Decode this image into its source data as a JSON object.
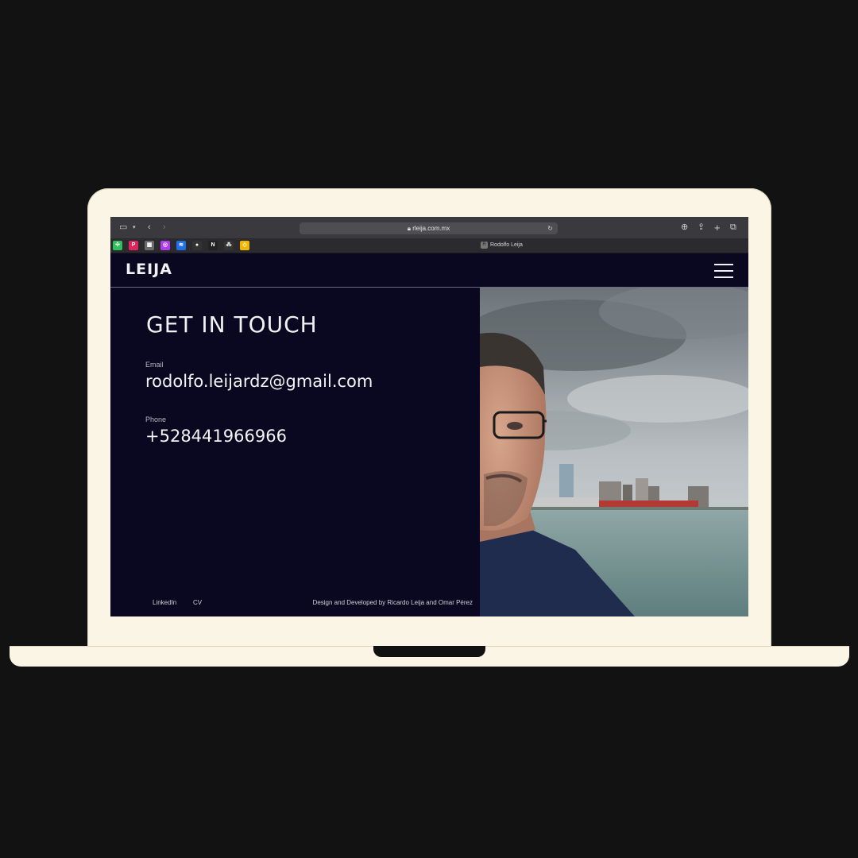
{
  "browser": {
    "url": "rleija.com.mx",
    "tab_title": "Rodolfo Leija",
    "tab_favicon_letter": "R",
    "favorites": [
      {
        "name": "app-icon-1",
        "color": "#2fbf5b",
        "glyph": "✣"
      },
      {
        "name": "app-icon-2",
        "color": "#e0245e",
        "glyph": "P"
      },
      {
        "name": "app-icon-3",
        "color": "#6b6b6b",
        "glyph": "▦"
      },
      {
        "name": "app-icon-4",
        "color": "#b03cf0",
        "glyph": "◎"
      },
      {
        "name": "app-icon-5",
        "color": "#1e6fe8",
        "glyph": "≋"
      },
      {
        "name": "github-icon",
        "color": "#333333",
        "glyph": "●"
      },
      {
        "name": "app-icon-7",
        "color": "#222222",
        "glyph": "N"
      },
      {
        "name": "app-icon-8",
        "color": "#333333",
        "glyph": "⁂"
      },
      {
        "name": "app-icon-9",
        "color": "#f1b600",
        "glyph": "◇"
      }
    ]
  },
  "site": {
    "logo": "LEIJA",
    "heading": "GET IN TOUCH",
    "email_label": "Email",
    "email": "rodolfo.leijardz@gmail.com",
    "phone_label": "Phone",
    "phone": "+528441966966",
    "footer": {
      "linkedin": "LinkedIn",
      "cv": "CV",
      "credit": "Design and Developed by Ricardo Leija and Omar Pérez"
    }
  },
  "colors": {
    "page_background": "#121212",
    "laptop_body": "#faf5e4",
    "site_background": "#0a0820",
    "text": "#f1f1f3"
  }
}
